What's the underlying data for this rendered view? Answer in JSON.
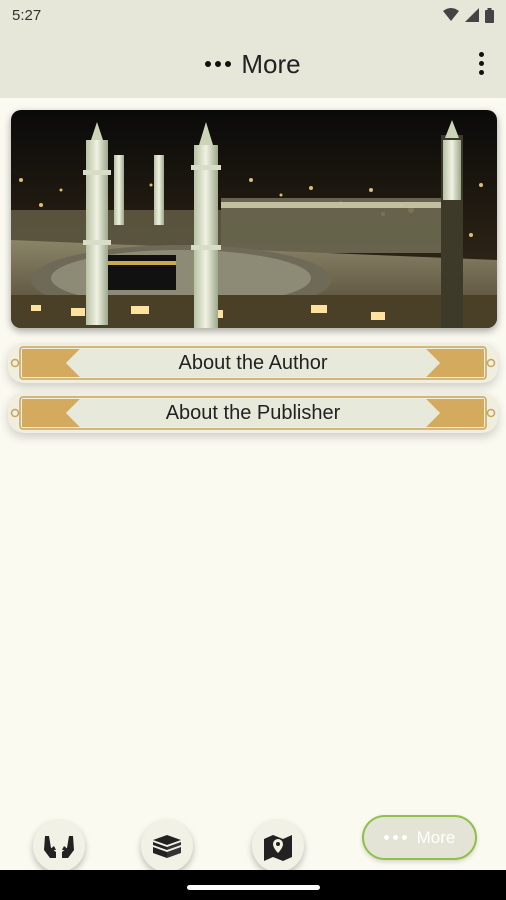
{
  "status_bar": {
    "time": "5:27"
  },
  "app_bar": {
    "title": "More"
  },
  "hero": {
    "image": "kaaba-night-photo"
  },
  "menu": {
    "items": [
      {
        "label": "About the Author"
      },
      {
        "label": "About the Publisher"
      }
    ]
  },
  "bottom_nav": {
    "items": [
      {
        "icon": "praying-hands-icon"
      },
      {
        "icon": "kaaba-icon"
      },
      {
        "icon": "map-icon"
      }
    ],
    "active_label": "More",
    "active_color": "#8fc04a"
  },
  "colors": {
    "bar_bg": "#e6e7d8",
    "page_bg": "#fbfaf1",
    "gold": "#d4aa5f"
  }
}
